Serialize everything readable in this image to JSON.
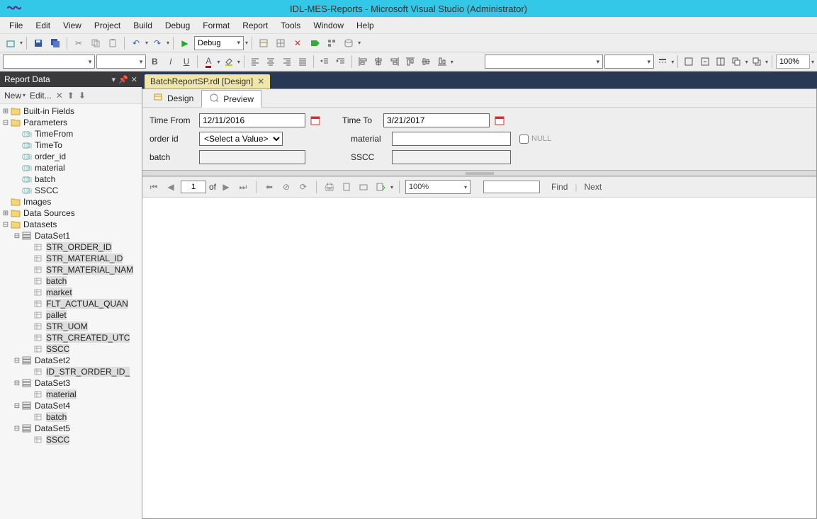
{
  "title": "IDL-MES-Reports - Microsoft Visual Studio (Administrator)",
  "menu": [
    "File",
    "Edit",
    "View",
    "Project",
    "Build",
    "Debug",
    "Format",
    "Report",
    "Tools",
    "Window",
    "Help"
  ],
  "toolbar1": {
    "config": "Debug"
  },
  "toolbar2": {
    "zoom": "100%"
  },
  "panel": {
    "title": "Report Data",
    "toolbar": {
      "new": "New",
      "edit": "Edit..."
    }
  },
  "tree": {
    "builtin": "Built-in Fields",
    "parameters": "Parameters",
    "params": [
      "TimeFrom",
      "TimeTo",
      "order_id",
      "material",
      "batch",
      "SSCC"
    ],
    "images": "Images",
    "datasources": "Data Sources",
    "datasets": "Datasets",
    "ds1": {
      "name": "DataSet1",
      "fields": [
        "STR_ORDER_ID",
        "STR_MATERIAL_ID",
        "STR_MATERIAL_NAM",
        "batch",
        "market",
        "FLT_ACTUAL_QUAN",
        "pallet",
        "STR_UOM",
        "STR_CREATED_UTC",
        "SSCC"
      ]
    },
    "ds2": {
      "name": "DataSet2",
      "fields": [
        "ID_STR_ORDER_ID_"
      ]
    },
    "ds3": {
      "name": "DataSet3",
      "fields": [
        "material"
      ]
    },
    "ds4": {
      "name": "DataSet4",
      "fields": [
        "batch"
      ]
    },
    "ds5": {
      "name": "DataSet5",
      "fields": [
        "SSCC"
      ]
    }
  },
  "doc": {
    "tab": "BatchReportSP.rdl [Design]",
    "subtabs": {
      "design": "Design",
      "preview": "Preview"
    }
  },
  "form": {
    "timeFromLabel": "Time From",
    "timeFromValue": "12/11/2016",
    "timeToLabel": "Time To",
    "timeToValue": "3/21/2017",
    "orderIdLabel": "order id",
    "orderIdValue": "<Select a Value>",
    "materialLabel": "material",
    "nullLabel": "NULL",
    "batchLabel": "batch",
    "ssccLabel": "SSCC"
  },
  "viewer": {
    "page": "1",
    "of": "of",
    "zoom": "100%",
    "find": "Find",
    "next": "Next"
  }
}
